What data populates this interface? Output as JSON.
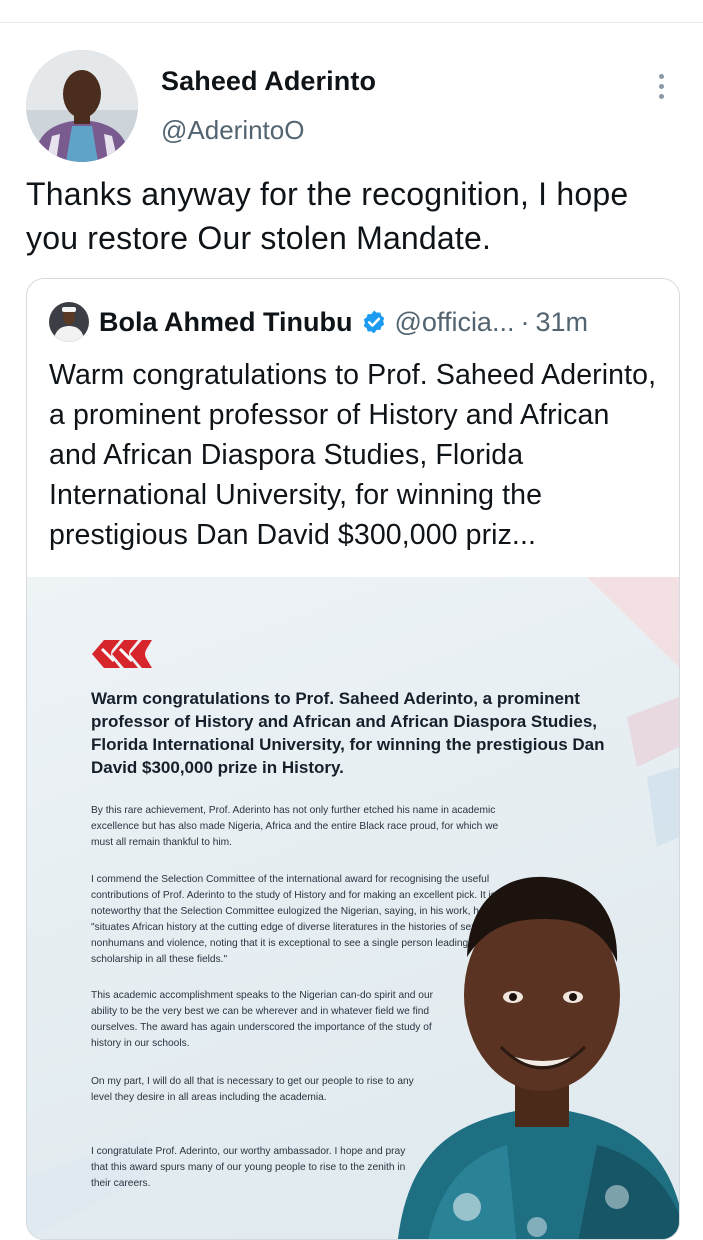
{
  "tweet": {
    "author_name": "Saheed Aderinto",
    "author_handle": "@AderintoO",
    "text": "Thanks anyway for the recognition, I hope you restore Our stolen Mandate.",
    "more_icon": "more-vertical-icon"
  },
  "quote": {
    "author_name": "Bola Ahmed Tinubu",
    "verified_icon": "verified-badge-icon",
    "handle": "@officia...",
    "separator": "·",
    "time": "31m",
    "text": "Warm congratulations to Prof. Saheed Aderinto, a prominent professor of History and African and African Diaspora Studies, Florida International University, for winning the prestigious Dan David $300,000 priz..."
  },
  "poster": {
    "logo_icon": "red-chain-logo-icon",
    "headline": "Warm congratulations to Prof. Saheed Aderinto, a prominent professor of History and African and African Diaspora Studies,  Florida International University, for winning the prestigious Dan David $300,000 prize in History.",
    "paragraphs": [
      "By this rare achievement, Prof. Aderinto has not only further etched his name in academic excellence but has also made Nigeria, Africa and the entire Black race proud, for which we must all remain thankful to him.",
      "I commend the Selection Committee of the international award for recognising the useful contributions of Prof. Aderinto to the study of History and for making an excellent pick. It is noteworthy that the Selection Committee eulogized the Nigerian, saying, in his work, he \"situates African history at the cutting edge of diverse literatures in the histories of sexuality, nonhumans and violence, noting that it is exceptional to see a single person leading scholarship in all these fields.\"",
      "This academic accomplishment speaks to the Nigerian can-do spirit and our ability to be the very best we can be wherever and in whatever field we find ourselves. The award has again underscored the importance of the study of history in our schools.",
      "On my part, I will do all that is necessary to get our people to rise to any level they desire in all areas including the academia.",
      "I congratulate Prof. Aderinto, our worthy ambassador. I hope and pray that this award spurs many of our young people to rise to the zenith in their careers."
    ]
  },
  "colors": {
    "text_primary": "#0f1419",
    "text_secondary": "#536471",
    "verified_blue": "#1d9bf0",
    "logo_red": "#d7262b",
    "border": "#d4dadf"
  }
}
